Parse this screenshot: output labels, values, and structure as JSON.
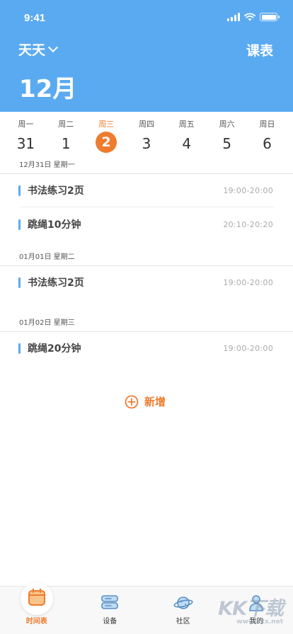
{
  "status": {
    "time": "9:41"
  },
  "header": {
    "user_name": "天天",
    "schedule_label": "课表",
    "month": "12月"
  },
  "week": [
    {
      "name": "周一",
      "num": "31"
    },
    {
      "name": "周二",
      "num": "1"
    },
    {
      "name": "周三",
      "num": "2"
    },
    {
      "name": "周四",
      "num": "3"
    },
    {
      "name": "周五",
      "num": "4"
    },
    {
      "name": "周六",
      "num": "5"
    },
    {
      "name": "周日",
      "num": "6"
    }
  ],
  "sections": [
    {
      "date": "12月31日  星期一",
      "items": [
        {
          "title": "书法练习2页",
          "time": "19:00-20:00"
        },
        {
          "title": "跳绳10分钟",
          "time": "20:10-20:20"
        }
      ]
    },
    {
      "date": "01月01日  星期二",
      "items": [
        {
          "title": "书法练习2页",
          "time": "19:00-20:00"
        }
      ]
    },
    {
      "date": "01月02日  星期三",
      "items": [
        {
          "title": "跳绳20分钟",
          "time": "19:00-20:00"
        }
      ]
    }
  ],
  "add_label": "新增",
  "tabs": [
    {
      "label": "时间表",
      "icon": "calendar-icon"
    },
    {
      "label": "设备",
      "icon": "device-icon"
    },
    {
      "label": "社区",
      "icon": "planet-icon"
    },
    {
      "label": "我的",
      "icon": "person-icon"
    }
  ],
  "watermark": {
    "logo": "KK下载",
    "url": "www.kkx.net"
  },
  "colors": {
    "header": "#5aaaf2",
    "accent": "#ee7c2e",
    "bar": "#5aaaf2"
  }
}
